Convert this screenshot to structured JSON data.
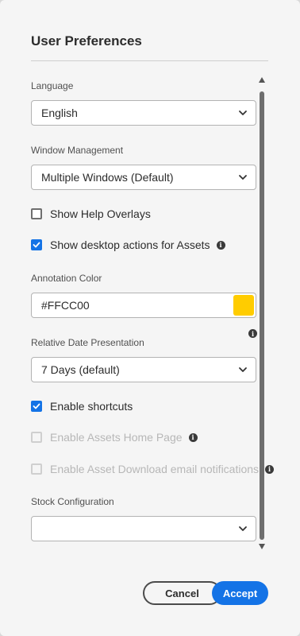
{
  "dialog": {
    "title": "User Preferences"
  },
  "language": {
    "label": "Language",
    "value": "English"
  },
  "window_management": {
    "label": "Window Management",
    "value": "Multiple Windows (Default)"
  },
  "checkboxes": {
    "show_help_overlays": {
      "label": "Show Help Overlays",
      "checked": false,
      "disabled": false
    },
    "show_desktop_actions": {
      "label": "Show desktop actions for Assets",
      "checked": true,
      "disabled": false
    },
    "enable_shortcuts": {
      "label": "Enable shortcuts",
      "checked": true,
      "disabled": false
    },
    "enable_assets_home": {
      "label": "Enable Assets Home Page",
      "checked": false,
      "disabled": true
    },
    "enable_download_email": {
      "label": "Enable Asset Download email notifications",
      "checked": false,
      "disabled": true
    }
  },
  "annotation_color": {
    "label": "Annotation Color",
    "value": "#FFCC00",
    "swatch": "#ffcc00"
  },
  "relative_date": {
    "label": "Relative Date Presentation",
    "value": "7 Days (default)"
  },
  "stock_configuration": {
    "label": "Stock Configuration",
    "value": ""
  },
  "footer": {
    "cancel_label": "Cancel",
    "accept_label": "Accept"
  },
  "colors": {
    "accent": "#1473e6",
    "background": "#f5f5f5"
  }
}
